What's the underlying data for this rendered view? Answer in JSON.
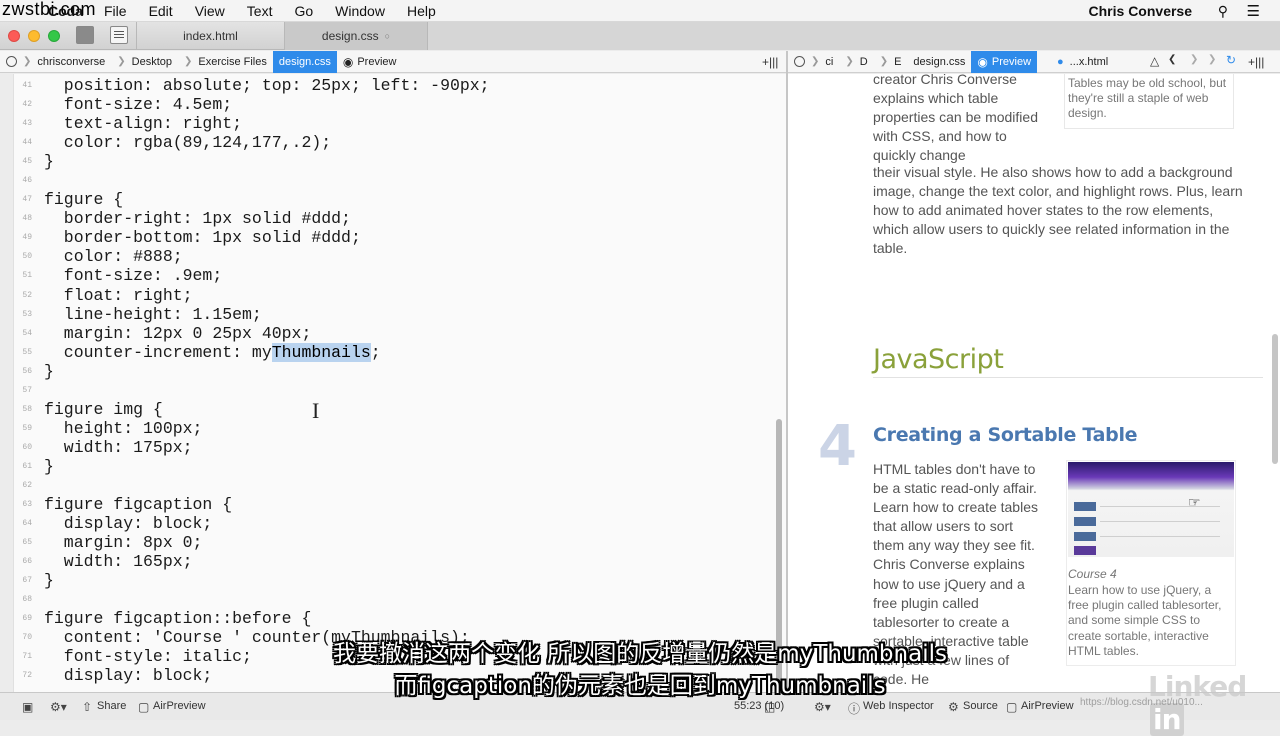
{
  "menubar": {
    "watermark": "zwstbi.com",
    "app": "Coda",
    "menus": [
      "File",
      "Edit",
      "View",
      "Text",
      "Go",
      "Window",
      "Help"
    ],
    "user": "Chris Converse"
  },
  "tabs": [
    {
      "label": "index.html",
      "active": false
    },
    {
      "label": "design.css",
      "active": true
    }
  ],
  "path_left": [
    "chrisconverse",
    "Desktop",
    "Exercise Files",
    "design.css",
    "Preview"
  ],
  "path_right": [
    "ci",
    "D",
    "E",
    "design.css",
    "Preview",
    "...x.html"
  ],
  "editor": {
    "lines": [
      {
        "n": "41",
        "code": "  position: absolute; top: 25px; left: -90px;"
      },
      {
        "n": "42",
        "code": "  font-size: 4.5em;"
      },
      {
        "n": "43",
        "code": "  text-align: right;"
      },
      {
        "n": "44",
        "code": "  color: rgba(89,124,177,.2);"
      },
      {
        "n": "45",
        "code": "}"
      },
      {
        "n": "46",
        "code": ""
      },
      {
        "n": "47",
        "code": "figure {"
      },
      {
        "n": "48",
        "code": "  border-right: 1px solid #ddd;"
      },
      {
        "n": "49",
        "code": "  border-bottom: 1px solid #ddd;"
      },
      {
        "n": "50",
        "code": "  color: #888;"
      },
      {
        "n": "51",
        "code": "  font-size: .9em;"
      },
      {
        "n": "52",
        "code": "  float: right;"
      },
      {
        "n": "53",
        "code": "  line-height: 1.15em;"
      },
      {
        "n": "54",
        "code": "  margin: 12px 0 25px 40px;"
      },
      {
        "n": "55",
        "code": "  counter-increment: my",
        "selected": "Thumbnails",
        "after": ";"
      },
      {
        "n": "56",
        "code": "}"
      },
      {
        "n": "57",
        "code": ""
      },
      {
        "n": "58",
        "code": "figure img {"
      },
      {
        "n": "59",
        "code": "  height: 100px;"
      },
      {
        "n": "60",
        "code": "  width: 175px;"
      },
      {
        "n": "61",
        "code": "}"
      },
      {
        "n": "62",
        "code": ""
      },
      {
        "n": "63",
        "code": "figure figcaption {"
      },
      {
        "n": "64",
        "code": "  display: block;"
      },
      {
        "n": "65",
        "code": "  margin: 8px 0;"
      },
      {
        "n": "66",
        "code": "  width: 165px;"
      },
      {
        "n": "67",
        "code": "}"
      },
      {
        "n": "68",
        "code": ""
      },
      {
        "n": "69",
        "code": "figure figcaption::before {"
      },
      {
        "n": "70",
        "code": "  content: 'Course ' counter(myThumbnails);"
      },
      {
        "n": "71",
        "code": "  font-style: italic;"
      },
      {
        "n": "72",
        "code": "  display: block;"
      }
    ]
  },
  "preview": {
    "intro": "creator Chris Converse explains which table properties can be modified with CSS, and how to quickly change",
    "full": "their visual style. He also shows how to add a background image, change the text color, and highlight rows. Plus, learn how to add animated hover states to the row elements, which allow users to quickly see related information in the table.",
    "side_caption": "Tables may be old school, but they're still a staple of web design.",
    "section_heading": "JavaScript",
    "course_number": "4",
    "course_title": "Creating a Sortable Table",
    "course_desc": "HTML tables don't have to be a static read-only affair. Learn how to create tables that allow users to sort them any way they see fit. Chris Converse explains how to use jQuery and a free plugin called tablesorter to create a sortable, interactive table with just a few lines of code. He",
    "figure_caption_title": "Course 4",
    "figure_caption": "Learn how to use jQuery, a free plugin called tablesorter, and some simple CSS to create sortable, interactive HTML tables."
  },
  "statusbar": {
    "share": "Share",
    "airpreview": "AirPreview",
    "position": "55:23 (10)",
    "web_inspector": "Web Inspector",
    "source": "Source",
    "airpreview_right": "AirPreview"
  },
  "subtitles": {
    "line1": "我要撤消这两个变化  所以图的反增量仍然是myThumbnails",
    "line2": "而figcaption的伪元素也是回到myThumbnails"
  },
  "watermark_logo": "Linked",
  "watermark_url": "https://blog.csdn.net/u010..."
}
